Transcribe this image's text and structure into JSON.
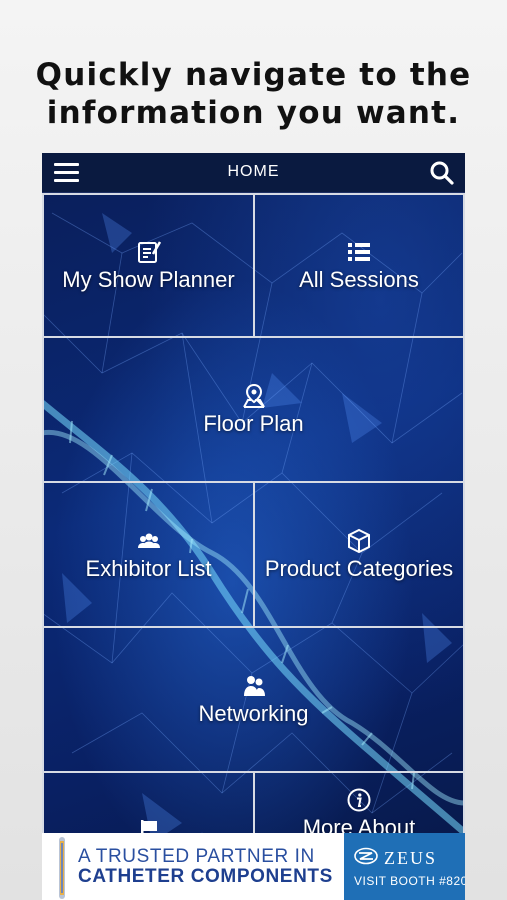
{
  "headline": {
    "line1": "Quickly navigate to the",
    "line2": "information you want."
  },
  "navbar": {
    "title": "HOME",
    "menu_icon": "hamburger-menu-icon",
    "search_icon": "search-icon"
  },
  "tiles": [
    {
      "label": "My Show Planner",
      "icon": "planner-checklist-icon"
    },
    {
      "label": "All Sessions",
      "icon": "list-icon"
    },
    {
      "label": "Floor Plan",
      "icon": "map-pin-icon"
    },
    {
      "label": "Exhibitor List",
      "icon": "people-group-icon"
    },
    {
      "label": "Product Categories",
      "icon": "box-icon"
    },
    {
      "label": "Networking",
      "icon": "two-people-icon"
    },
    {
      "label": "",
      "icon": "flag-icon"
    },
    {
      "label": "More About",
      "icon": "info-icon"
    }
  ],
  "ad": {
    "line1": "A TRUSTED PARTNER IN",
    "line2": "CATHETER COMPONENTS",
    "brand": "ZEUS",
    "booth": "VISIT BOOTH #820"
  },
  "colors": {
    "navbar_bg": "#0a1a40",
    "tile_border": "#d7dbe4",
    "ad_brand_bg": "#1f6fb6",
    "ad_text": "#2a4fa0"
  }
}
